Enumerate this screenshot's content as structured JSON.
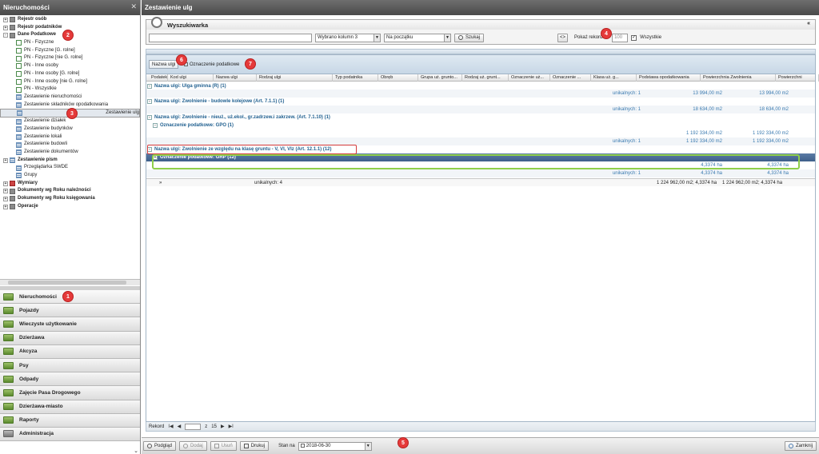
{
  "left_panel": {
    "title": "Nieruchomości",
    "tree": [
      {
        "label": "Rejestr osób",
        "level": 0,
        "exp": "+",
        "icon": "folder",
        "bold": true
      },
      {
        "label": "Rejestr podatników",
        "level": 0,
        "exp": "+",
        "icon": "folder",
        "bold": true
      },
      {
        "label": "Dane Podatkowe",
        "level": 0,
        "exp": "-",
        "icon": "folder",
        "bold": true
      },
      {
        "label": "PN - Fizyczne",
        "level": 1,
        "icon": "doc"
      },
      {
        "label": "PN - Fizyczne [G. rolne]",
        "level": 1,
        "icon": "doc"
      },
      {
        "label": "PN - Fizyczne [nie G. rolne]",
        "level": 1,
        "icon": "doc"
      },
      {
        "label": "PN - Inne osoby",
        "level": 1,
        "icon": "doc"
      },
      {
        "label": "PN - Inne osoby [G. rolne]",
        "level": 1,
        "icon": "doc"
      },
      {
        "label": "PN - Inne osoby [nie G. rolne]",
        "level": 1,
        "icon": "doc"
      },
      {
        "label": "PN - Wszystkie",
        "level": 1,
        "icon": "doc"
      },
      {
        "label": "Zestawienie nieruchomości",
        "level": 1,
        "icon": "grid"
      },
      {
        "label": "Zestawienie składników opodatkowania",
        "level": 1,
        "icon": "grid"
      },
      {
        "label": "Zestawienie ulg",
        "level": 1,
        "icon": "grid",
        "selected": true
      },
      {
        "label": "Zestawienie działek",
        "level": 1,
        "icon": "grid"
      },
      {
        "label": "Zestawienie budynków",
        "level": 1,
        "icon": "grid"
      },
      {
        "label": "Zestawienie lokali",
        "level": 1,
        "icon": "grid"
      },
      {
        "label": "Zestawienie budowli",
        "level": 1,
        "icon": "grid"
      },
      {
        "label": "Zestawienie dokumentów",
        "level": 1,
        "icon": "grid"
      },
      {
        "label": "Zestawienie pism",
        "level": 0,
        "exp": "+",
        "icon": "grid",
        "bold": true
      },
      {
        "label": "Przeglądarka SWDE",
        "level": 1,
        "icon": "grid"
      },
      {
        "label": "Grupy",
        "level": 1,
        "icon": "grid"
      },
      {
        "label": "Wymiary",
        "level": 0,
        "exp": "+",
        "icon": "red",
        "bold": true
      },
      {
        "label": "Dokumenty wg Roku należności",
        "level": 0,
        "exp": "+",
        "icon": "folder",
        "bold": true
      },
      {
        "label": "Dokumenty wg Roku księgowania",
        "level": 0,
        "exp": "+",
        "icon": "folder",
        "bold": true
      },
      {
        "label": "Operacje",
        "level": 0,
        "exp": "+",
        "icon": "folder",
        "bold": true
      }
    ],
    "modules": [
      {
        "label": "Nieruchomości",
        "active": true
      },
      {
        "label": "Pojazdy"
      },
      {
        "label": "Wieczyste użytkowanie"
      },
      {
        "label": "Dzierżawa"
      },
      {
        "label": "Akcyza"
      },
      {
        "label": "Psy"
      },
      {
        "label": "Odpady"
      },
      {
        "label": "Zajęcie Pasa Drogowego"
      },
      {
        "label": "Dzierżawa-miasto"
      },
      {
        "label": "Raporty"
      },
      {
        "label": "Administracja",
        "admin": true
      }
    ]
  },
  "right_panel": {
    "title": "Zestawienie ulg",
    "search": {
      "title": "Wyszukiwarka",
      "query_value": "",
      "column_select": "Wybrano kolumn 3",
      "match_select": "Na początku",
      "search_button": "Szukaj",
      "records_label": "Pokaż rekordów",
      "records_value": "100",
      "all_label": "Wszystkie",
      "all_checked": true,
      "collapse_glyph": "«"
    },
    "group_chips": [
      "Nazwa ulgi",
      "Oznaczenie podatkowe"
    ],
    "columns": [
      "Podatek",
      "Kod ulgi",
      "Nazwa ulgi",
      "Rodzaj ulgi",
      "Typ podatnika",
      "Obręb",
      "Grupa uż. grunto...",
      "Rodzaj uż. grunt...",
      "Oznaczenie uż...",
      "Oznaczenie ...",
      "Klasa uż. g...",
      "Podstawa opodatkowania",
      "Powierzchnia Zwolnienia",
      "Powierzchni"
    ],
    "rows": [
      {
        "kind": "group",
        "text": "Nazwa ulgi: Ulga gminna (R)  (1)",
        "exp": "-"
      },
      {
        "kind": "sum",
        "unique": "unikalnych: 1",
        "base": "13 994,00 m2",
        "area": "13 994,00 m2"
      },
      {
        "kind": "group",
        "text": "Nazwa ulgi: Zwolnienie - budowle kolejowe (Art. 7.1.1)  (1)",
        "exp": "-"
      },
      {
        "kind": "sum",
        "unique": "unikalnych: 1",
        "base": "18 634,00 m2",
        "area": "18 634,00 m2"
      },
      {
        "kind": "group",
        "text": "Nazwa ulgi: Zwolnienie - nieuż., uż.ekol., gr.zadrzew.i zakrzew. (Art. 7.1.10)  (1)",
        "exp": "-"
      },
      {
        "kind": "subgroup",
        "text": "Oznaczenie podatkowe: GPO  (1)",
        "exp": "-"
      },
      {
        "kind": "sum",
        "unique": "",
        "base": "1 192 334,00 m2",
        "area": "1 192 334,00 m2"
      },
      {
        "kind": "sum",
        "unique": "unikalnych: 1",
        "base": "1 192 334,00 m2",
        "area": "1 192 334,00 m2"
      },
      {
        "kind": "group",
        "text": "Nazwa ulgi: Zwolnienie ze względu na klasę gruntu - V, VI, VIz (Art. 12.1.1)  (12)",
        "exp": "-"
      },
      {
        "kind": "selected",
        "text": "Oznaczenie podatkowe: GRP  (12)",
        "exp": "+"
      },
      {
        "kind": "sum",
        "unique": "",
        "base": "4,3374 ha",
        "area": "4,3374 ha"
      },
      {
        "kind": "sum",
        "unique": "unikalnych: 1",
        "base": "4,3374 ha",
        "area": "4,3374 ha"
      }
    ],
    "footer": {
      "unique": "unikalnych: 4",
      "base": "1 224 962,00 m2; 4,3374 ha",
      "area": "1 224 962,00 m2; 4,3374 ha",
      "scroll_glyph": "»"
    },
    "pager": {
      "label": "Rekord",
      "first": "I◀",
      "prev": "◀",
      "page": "",
      "of_label": "z",
      "total": "15",
      "next": "▶",
      "last": "▶I"
    },
    "bottom": {
      "preview": "Podgląd",
      "add": "Dodaj",
      "delete": "Usuń",
      "print": "Drukuj",
      "state_label": "Stan na",
      "state_date": "2018-06-30",
      "close": "Zamknij"
    }
  },
  "annotations": [
    "1",
    "2",
    "3",
    "4",
    "5",
    "6",
    "7"
  ],
  "colors": {
    "group_text": "#1f5f8f",
    "sum_text": "#3a7ab0",
    "selected_row": "#4a6b96",
    "badge": "#e53a3a",
    "highlight_red": "#d43a3a",
    "highlight_green": "#8fcf4a"
  }
}
